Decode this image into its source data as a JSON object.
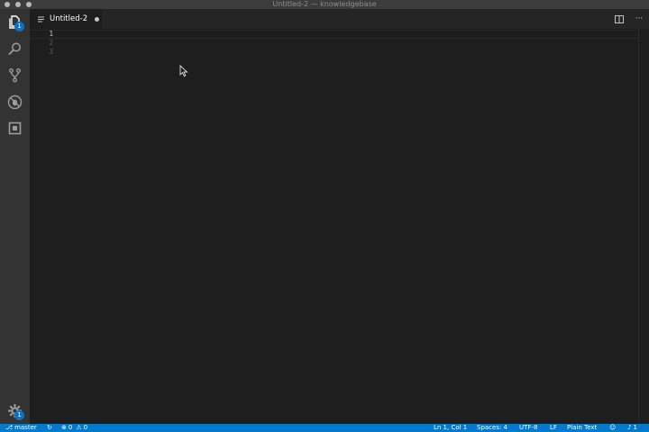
{
  "window": {
    "title": "Untitled-2 — knowledgebase"
  },
  "activity_bar": {
    "items": [
      {
        "name": "explorer",
        "icon": "files-icon",
        "badge": "1"
      },
      {
        "name": "search",
        "icon": "search-icon"
      },
      {
        "name": "source-control",
        "icon": "source-control-icon"
      },
      {
        "name": "debug",
        "icon": "debug-icon"
      },
      {
        "name": "extensions",
        "icon": "extensions-icon"
      }
    ],
    "manage_badge": "1"
  },
  "editor": {
    "tab": {
      "label": "Untitled-2",
      "dirty": true
    },
    "actions": {
      "split_icon": "split-editor-icon",
      "more_label": "···"
    },
    "line_numbers": [
      "1",
      "2",
      "3"
    ]
  },
  "status_bar": {
    "branch": "master",
    "sync_icon": "sync-icon",
    "errors": "0",
    "warnings": "0",
    "position": "Ln 1, Col 1",
    "spaces": "Spaces: 4",
    "encoding": "UTF-8",
    "eol": "LF",
    "language": "Plain Text",
    "notifications": "1"
  },
  "colors": {
    "accent": "#007acc",
    "badge": "#0e70c0",
    "background": "#1e1e1e",
    "activity_bar": "#333333",
    "tab_bar": "#252526"
  }
}
